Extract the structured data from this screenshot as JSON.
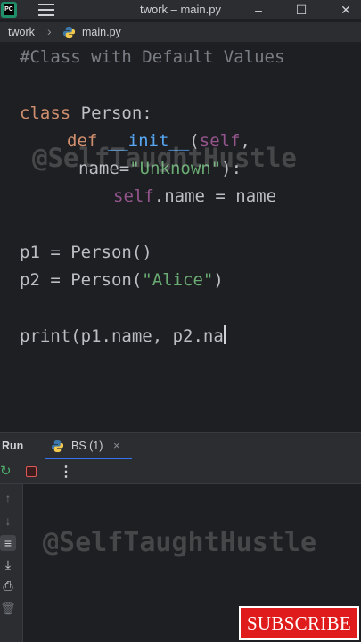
{
  "window": {
    "title": "twork – main.py",
    "minimize": "–",
    "maximize": "☐",
    "close": "✕",
    "logo_text": "PC"
  },
  "breadcrumb": {
    "project": "twork",
    "separator": "›",
    "file": "main.py"
  },
  "editor": {
    "comment": "#Class with Default Values",
    "line_class_kw": "class",
    "line_class_rest": " Person:",
    "def_kw": "def",
    "def_name": "__init__",
    "def_open": "(",
    "def_self": "self",
    "def_comma": ",",
    "param_name": "name=",
    "param_default": "\"Unknown\"",
    "param_close": "):",
    "assign_self": "self",
    "assign_rest": ".name = name",
    "p1_line": "p1 = Person()",
    "p2_start": "p2 = Person(",
    "p2_arg": "\"Alice\"",
    "p2_end": ")",
    "print_line": "print(p1.name, p2.na"
  },
  "watermark": "@SelfTaughtHustle",
  "run_panel": {
    "title": "Run",
    "tab_label": "BS (1)",
    "tab_close": "×",
    "more": "⋮"
  },
  "subscribe_label": "SUBSCRIBE",
  "colors": {
    "keyword": "#cf8e6d",
    "function": "#56a8f5",
    "self": "#94558d",
    "string": "#6aab73",
    "accent": "#3574f0",
    "subscribe_bg": "#e01b1b"
  }
}
